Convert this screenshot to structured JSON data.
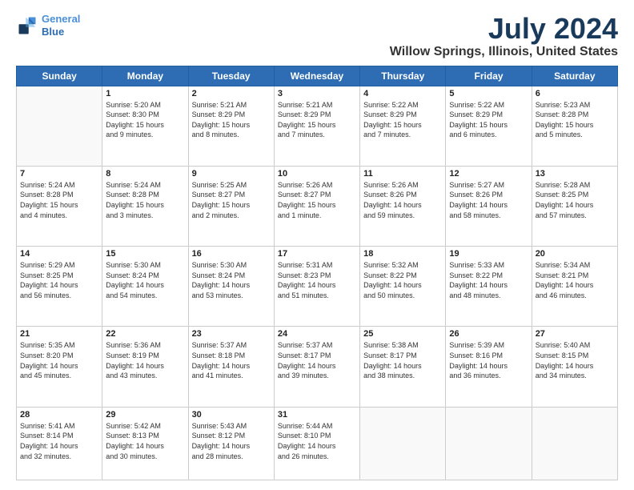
{
  "logo": {
    "line1": "General",
    "line2": "Blue"
  },
  "title": "July 2024",
  "subtitle": "Willow Springs, Illinois, United States",
  "days_of_week": [
    "Sunday",
    "Monday",
    "Tuesday",
    "Wednesday",
    "Thursday",
    "Friday",
    "Saturday"
  ],
  "weeks": [
    [
      {
        "day": "",
        "info": ""
      },
      {
        "day": "1",
        "info": "Sunrise: 5:20 AM\nSunset: 8:30 PM\nDaylight: 15 hours\nand 9 minutes."
      },
      {
        "day": "2",
        "info": "Sunrise: 5:21 AM\nSunset: 8:29 PM\nDaylight: 15 hours\nand 8 minutes."
      },
      {
        "day": "3",
        "info": "Sunrise: 5:21 AM\nSunset: 8:29 PM\nDaylight: 15 hours\nand 7 minutes."
      },
      {
        "day": "4",
        "info": "Sunrise: 5:22 AM\nSunset: 8:29 PM\nDaylight: 15 hours\nand 7 minutes."
      },
      {
        "day": "5",
        "info": "Sunrise: 5:22 AM\nSunset: 8:29 PM\nDaylight: 15 hours\nand 6 minutes."
      },
      {
        "day": "6",
        "info": "Sunrise: 5:23 AM\nSunset: 8:28 PM\nDaylight: 15 hours\nand 5 minutes."
      }
    ],
    [
      {
        "day": "7",
        "info": "Sunrise: 5:24 AM\nSunset: 8:28 PM\nDaylight: 15 hours\nand 4 minutes."
      },
      {
        "day": "8",
        "info": "Sunrise: 5:24 AM\nSunset: 8:28 PM\nDaylight: 15 hours\nand 3 minutes."
      },
      {
        "day": "9",
        "info": "Sunrise: 5:25 AM\nSunset: 8:27 PM\nDaylight: 15 hours\nand 2 minutes."
      },
      {
        "day": "10",
        "info": "Sunrise: 5:26 AM\nSunset: 8:27 PM\nDaylight: 15 hours\nand 1 minute."
      },
      {
        "day": "11",
        "info": "Sunrise: 5:26 AM\nSunset: 8:26 PM\nDaylight: 14 hours\nand 59 minutes."
      },
      {
        "day": "12",
        "info": "Sunrise: 5:27 AM\nSunset: 8:26 PM\nDaylight: 14 hours\nand 58 minutes."
      },
      {
        "day": "13",
        "info": "Sunrise: 5:28 AM\nSunset: 8:25 PM\nDaylight: 14 hours\nand 57 minutes."
      }
    ],
    [
      {
        "day": "14",
        "info": "Sunrise: 5:29 AM\nSunset: 8:25 PM\nDaylight: 14 hours\nand 56 minutes."
      },
      {
        "day": "15",
        "info": "Sunrise: 5:30 AM\nSunset: 8:24 PM\nDaylight: 14 hours\nand 54 minutes."
      },
      {
        "day": "16",
        "info": "Sunrise: 5:30 AM\nSunset: 8:24 PM\nDaylight: 14 hours\nand 53 minutes."
      },
      {
        "day": "17",
        "info": "Sunrise: 5:31 AM\nSunset: 8:23 PM\nDaylight: 14 hours\nand 51 minutes."
      },
      {
        "day": "18",
        "info": "Sunrise: 5:32 AM\nSunset: 8:22 PM\nDaylight: 14 hours\nand 50 minutes."
      },
      {
        "day": "19",
        "info": "Sunrise: 5:33 AM\nSunset: 8:22 PM\nDaylight: 14 hours\nand 48 minutes."
      },
      {
        "day": "20",
        "info": "Sunrise: 5:34 AM\nSunset: 8:21 PM\nDaylight: 14 hours\nand 46 minutes."
      }
    ],
    [
      {
        "day": "21",
        "info": "Sunrise: 5:35 AM\nSunset: 8:20 PM\nDaylight: 14 hours\nand 45 minutes."
      },
      {
        "day": "22",
        "info": "Sunrise: 5:36 AM\nSunset: 8:19 PM\nDaylight: 14 hours\nand 43 minutes."
      },
      {
        "day": "23",
        "info": "Sunrise: 5:37 AM\nSunset: 8:18 PM\nDaylight: 14 hours\nand 41 minutes."
      },
      {
        "day": "24",
        "info": "Sunrise: 5:37 AM\nSunset: 8:17 PM\nDaylight: 14 hours\nand 39 minutes."
      },
      {
        "day": "25",
        "info": "Sunrise: 5:38 AM\nSunset: 8:17 PM\nDaylight: 14 hours\nand 38 minutes."
      },
      {
        "day": "26",
        "info": "Sunrise: 5:39 AM\nSunset: 8:16 PM\nDaylight: 14 hours\nand 36 minutes."
      },
      {
        "day": "27",
        "info": "Sunrise: 5:40 AM\nSunset: 8:15 PM\nDaylight: 14 hours\nand 34 minutes."
      }
    ],
    [
      {
        "day": "28",
        "info": "Sunrise: 5:41 AM\nSunset: 8:14 PM\nDaylight: 14 hours\nand 32 minutes."
      },
      {
        "day": "29",
        "info": "Sunrise: 5:42 AM\nSunset: 8:13 PM\nDaylight: 14 hours\nand 30 minutes."
      },
      {
        "day": "30",
        "info": "Sunrise: 5:43 AM\nSunset: 8:12 PM\nDaylight: 14 hours\nand 28 minutes."
      },
      {
        "day": "31",
        "info": "Sunrise: 5:44 AM\nSunset: 8:10 PM\nDaylight: 14 hours\nand 26 minutes."
      },
      {
        "day": "",
        "info": ""
      },
      {
        "day": "",
        "info": ""
      },
      {
        "day": "",
        "info": ""
      }
    ]
  ]
}
